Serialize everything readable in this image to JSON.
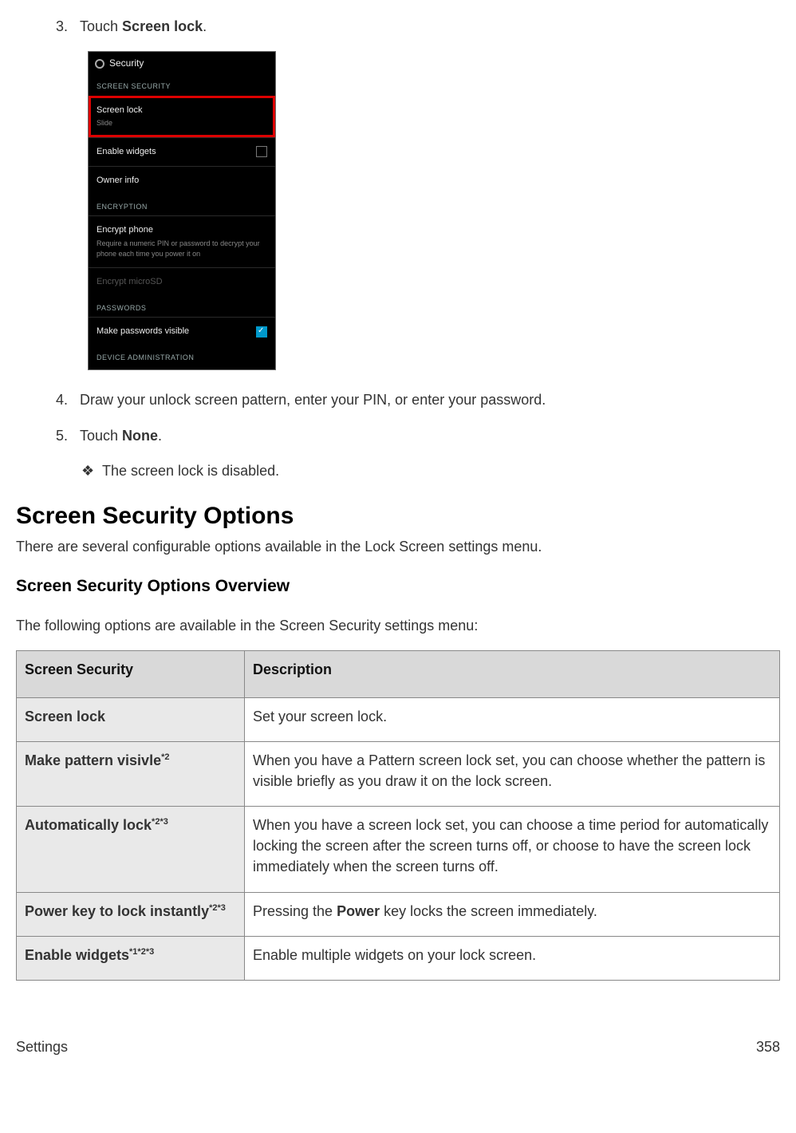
{
  "steps": {
    "s3_num": "3.",
    "s3_text_a": "Touch ",
    "s3_text_b": "Screen lock",
    "s3_text_c": ".",
    "s4_num": "4.",
    "s4_text": "Draw your unlock screen pattern, enter your PIN, or enter your password.",
    "s5_num": "5.",
    "s5_text_a": "Touch ",
    "s5_text_b": "None",
    "s5_text_c": ".",
    "bullet_mark": "❖",
    "bullet_text": "The screen lock is disabled."
  },
  "phone": {
    "title": "Security",
    "sec1": "SCREEN SECURITY",
    "row1_label": "Screen lock",
    "row1_sub": "Slide",
    "row2_label": "Enable widgets",
    "row3_label": "Owner info",
    "sec2": "ENCRYPTION",
    "row4_label": "Encrypt phone",
    "row4_sub": "Require a numeric PIN or password to decrypt your phone each time you power it on",
    "row5_label": "Encrypt microSD",
    "sec3": "PASSWORDS",
    "row6_label": "Make passwords visible",
    "sec4": "DEVICE ADMINISTRATION"
  },
  "section": {
    "heading": "Screen Security Options",
    "intro": "There are several configurable options available in the Lock Screen settings menu.",
    "subheading": "Screen Security Options Overview",
    "overview_intro": "The following options are available in the Screen Security settings menu:"
  },
  "table": {
    "h1": "Screen Security",
    "h2": "Description",
    "rows": [
      {
        "label": "Screen lock",
        "sup": "",
        "desc": "Set your screen lock."
      },
      {
        "label": "Make pattern visivle",
        "sup": "*2",
        "desc": "When you have a Pattern screen lock set, you can choose whether the pattern is visible briefly as you draw it on the lock screen."
      },
      {
        "label": "Automatically lock",
        "sup": "*2*3",
        "desc": "When you have a screen lock set, you can choose a time period for automatically locking the screen after the screen turns off, or choose to have the screen lock immediately when the screen turns off."
      },
      {
        "label": "Power key to lock instantly",
        "sup": "*2*3",
        "desc_a": "Pressing the ",
        "desc_b": "Power",
        "desc_c": " key locks the screen immediately."
      },
      {
        "label": "Enable widgets",
        "sup": "*1*2*3",
        "desc": "Enable multiple widgets on your lock screen."
      }
    ]
  },
  "footer": {
    "left": "Settings",
    "right": "358"
  }
}
